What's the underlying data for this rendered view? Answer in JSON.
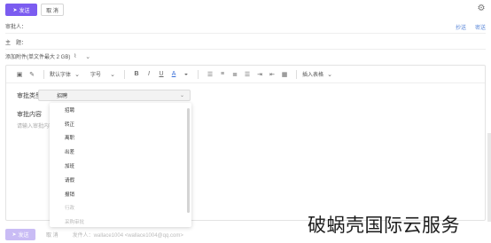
{
  "toolbar": {
    "send_label": "发送",
    "cancel_label": "取 消",
    "send_icon": "paper-plane-icon",
    "settings_icon": "gear-icon"
  },
  "recipient": {
    "label": "审批人：",
    "cc_label": "抄送",
    "bcc_label": "密送"
  },
  "subject": {
    "label": "主　题："
  },
  "attachment": {
    "label": "添加附件(单文件最大 2 GB)",
    "icon": "paperclip-icon"
  },
  "editor": {
    "font_family": "默认字体",
    "font_size": "字号",
    "insert_label": "插入表格",
    "approval_type_label": "审批类型",
    "approval_type_value": "招聘",
    "approval_content_label": "审批内容",
    "approval_content_placeholder": "请输入审批内容"
  },
  "dropdown": {
    "options": [
      "招聘",
      "转正",
      "离职",
      "出差",
      "加班",
      "请假",
      "报销",
      "行政",
      "采购审批"
    ]
  },
  "footer": {
    "send_label": "发送",
    "cancel_label": "取 消",
    "from_text": "发件人：wallace1004 <wallace1004@qq.com>"
  },
  "watermark": {
    "text": "破蜗壳国际云服务"
  }
}
